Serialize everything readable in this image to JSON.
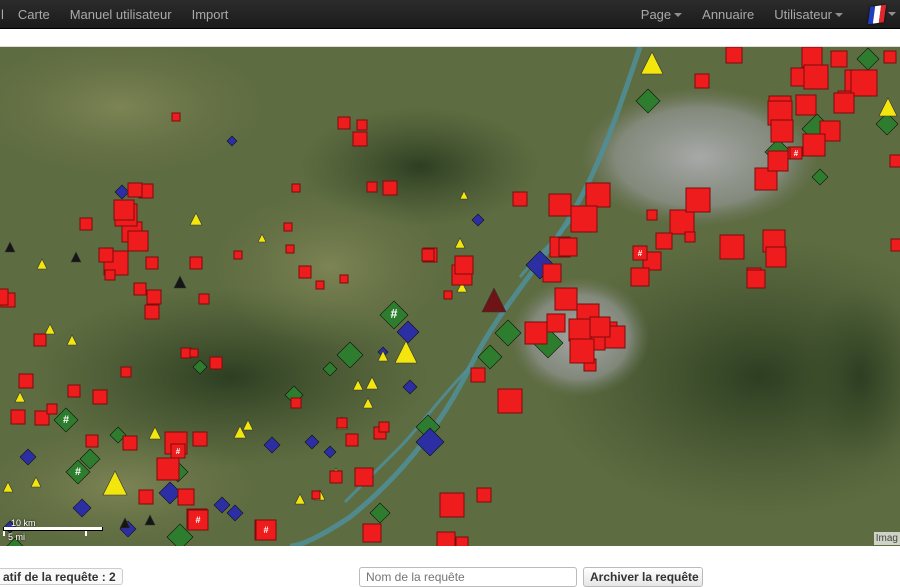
{
  "navbar": {
    "edge_label": "l",
    "left_items": [
      "Carte",
      "Manuel utilisateur",
      "Import"
    ],
    "page_menu": "Page",
    "annuaire": "Annuaire",
    "user_menu": "Utilisateur",
    "flag_colors": [
      "#1f3fbf",
      "#ffffff",
      "#e0262c"
    ]
  },
  "map": {
    "scale_top": "10 km",
    "scale_bottom": "5 mi",
    "attribution": "Imag",
    "marker_label": "#",
    "colors": {
      "red": "#ee1c1c",
      "green": "#2e7d2e",
      "blue": "#2c2fa3",
      "yellow": "#f2e60d",
      "black": "#151515",
      "darkred": "#6e1416",
      "gray": "#6f8f6a",
      "river": "#4f8f9a"
    }
  },
  "bottom": {
    "result_title": "atif de la requête : 2",
    "name_placeholder": "Nom de la requête",
    "save_label": "Archiver la requête"
  }
}
